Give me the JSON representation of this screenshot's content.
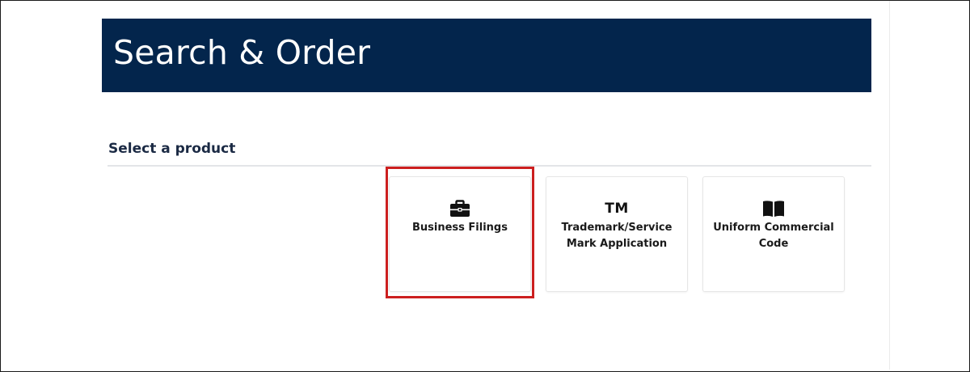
{
  "header": {
    "title": "Search & Order",
    "background_color": "#03254c"
  },
  "section": {
    "heading": "Select a product"
  },
  "products": [
    {
      "label": "Business Filings",
      "icon": "briefcase-icon",
      "selected": true
    },
    {
      "label": "Trademark/Service Mark Application",
      "icon": "trademark-icon",
      "icon_text": "TM",
      "selected": false
    },
    {
      "label": "Uniform Commercial Code",
      "icon": "book-icon",
      "selected": false
    }
  ],
  "highlight_color": "#cc1f1f"
}
